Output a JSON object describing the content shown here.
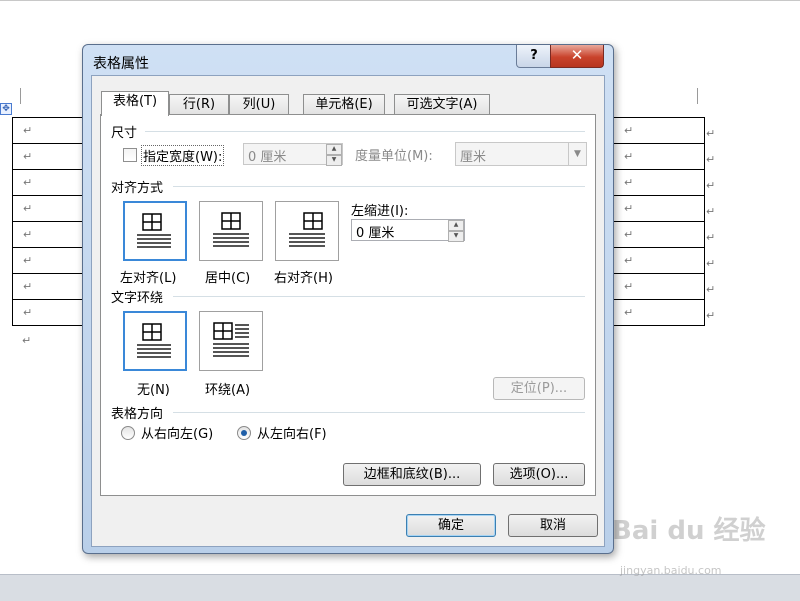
{
  "dialog": {
    "title": "表格属性",
    "help_label": "?",
    "close_label": "✕",
    "tabs": [
      {
        "label": "表格(T)",
        "active": true
      },
      {
        "label": "行(R)",
        "active": false
      },
      {
        "label": "列(U)",
        "active": false
      },
      {
        "label": "单元格(E)",
        "active": false
      },
      {
        "label": "可选文字(A)",
        "active": false
      }
    ]
  },
  "size": {
    "heading": "尺寸",
    "width_checkbox_label": "指定宽度(W):",
    "width_checked": false,
    "width_value": "0 厘米",
    "unit_label": "度量单位(M):",
    "unit_value": "厘米"
  },
  "alignment": {
    "heading": "对齐方式",
    "options": [
      {
        "label": "左对齐(L)",
        "selected": true
      },
      {
        "label": "居中(C)",
        "selected": false
      },
      {
        "label": "右对齐(H)",
        "selected": false
      }
    ],
    "indent_label": "左缩进(I):",
    "indent_value": "0 厘米"
  },
  "wrapping": {
    "heading": "文字环绕",
    "options": [
      {
        "label": "无(N)",
        "selected": true
      },
      {
        "label": "环绕(A)",
        "selected": false
      }
    ],
    "position_button": "定位(P)..."
  },
  "direction": {
    "heading": "表格方向",
    "rtl_label": "从右向左(G)",
    "ltr_label": "从左向右(F)",
    "selected": "ltr"
  },
  "buttons": {
    "borders": "边框和底纹(B)...",
    "options": "选项(O)...",
    "ok": "确定",
    "cancel": "取消"
  },
  "document": {
    "paragraph_mark": "↵"
  },
  "watermark": {
    "logo": "Bai du 经验",
    "url": "jingyan.baidu.com"
  }
}
